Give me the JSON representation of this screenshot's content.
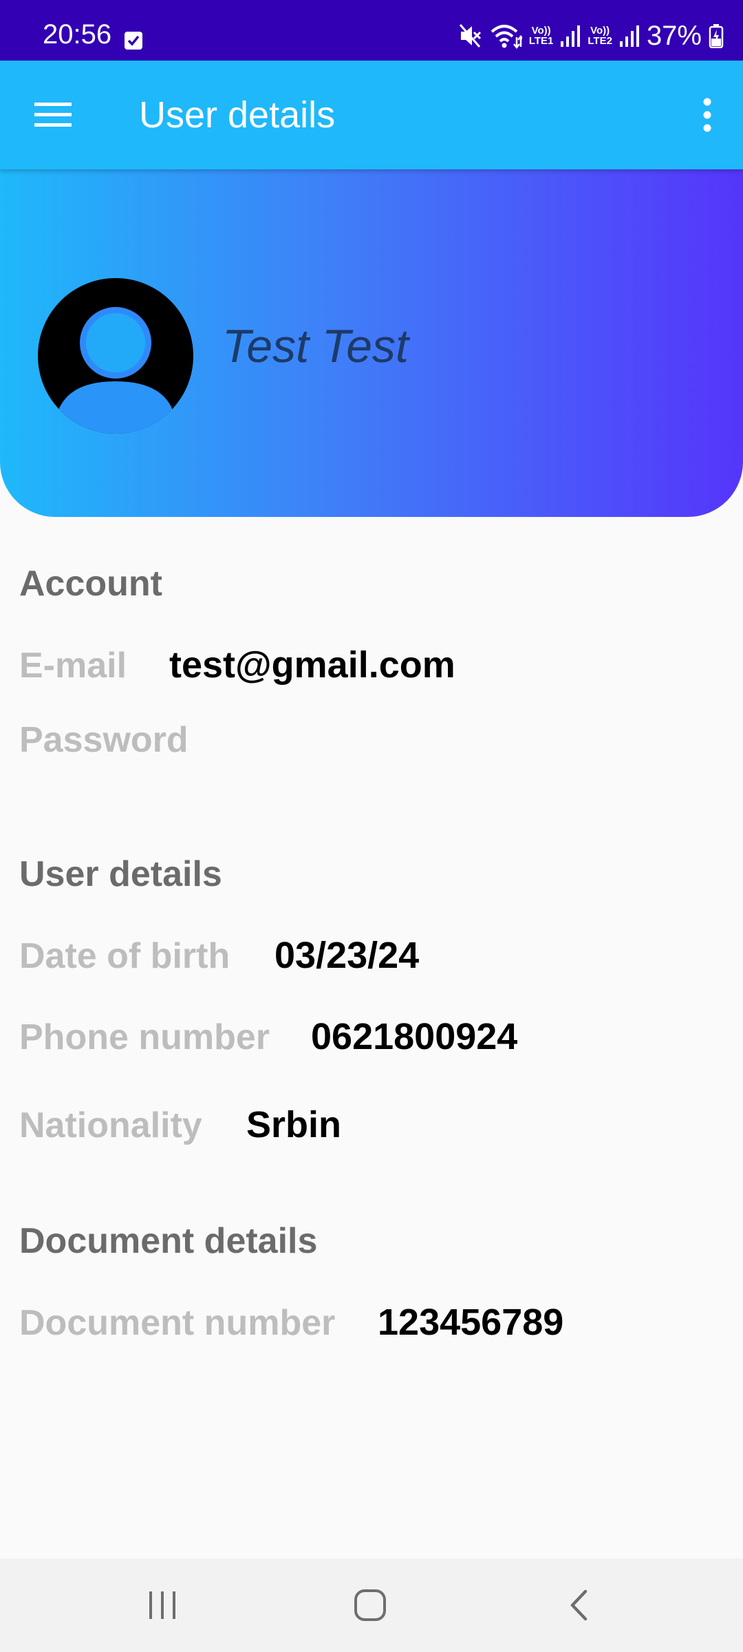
{
  "status_bar": {
    "time": "20:56",
    "battery": "37%",
    "sim1_top": "Vo))",
    "sim1_bottom": "LTE1",
    "sim2_top": "Vo))",
    "sim2_bottom": "LTE2",
    "icons": [
      "checkbox-notification-icon",
      "mute-icon",
      "wifi-icon",
      "signal-icon",
      "battery-icon"
    ]
  },
  "app_bar": {
    "title": "User details",
    "menu_icon": "hamburger-menu-icon",
    "more_icon": "more-vert-icon",
    "background": "#1fb8fa"
  },
  "profile": {
    "name": "Test Test",
    "avatar_icon": "account-circle-icon",
    "gradient": [
      "#1fb8fa",
      "#5535fb"
    ]
  },
  "sections": {
    "account": {
      "title": "Account",
      "email_label": "E-mail",
      "email_value": "test@gmail.com",
      "password_label": "Password"
    },
    "user_details": {
      "title": "User details",
      "dob_label": "Date of birth",
      "dob_value": "03/23/24",
      "phone_label": "Phone number",
      "phone_value": "0621800924",
      "nationality_label": "Nationality",
      "nationality_value": "Srbin"
    },
    "document": {
      "title": "Document details",
      "number_label": "Document number",
      "number_value": "123456789"
    }
  },
  "nav_bar": {
    "icons": [
      "recents-icon",
      "home-icon",
      "back-icon"
    ]
  }
}
